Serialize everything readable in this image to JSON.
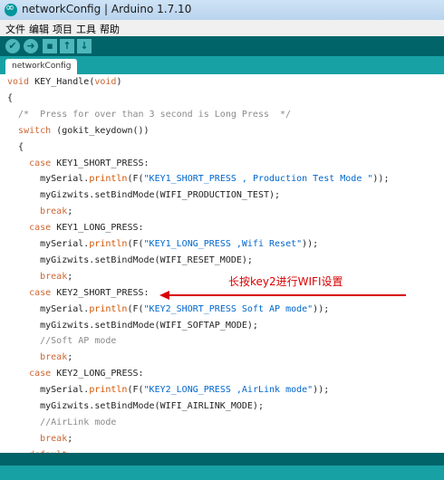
{
  "window": {
    "title": "networkConfig | Arduino 1.7.10"
  },
  "menu": [
    "文件",
    "编辑",
    "项目",
    "工具",
    "帮助"
  ],
  "toolbar": {
    "buttons": [
      {
        "name": "verify",
        "glyph": "✔"
      },
      {
        "name": "upload",
        "glyph": "➜"
      },
      {
        "name": "new",
        "glyph": "▪"
      },
      {
        "name": "open",
        "glyph": "↑"
      },
      {
        "name": "save",
        "glyph": "↓"
      }
    ]
  },
  "tab": {
    "label": "networkConfig"
  },
  "code": {
    "lines": [
      [
        {
          "t": "void",
          "c": "kw"
        },
        {
          "t": " KEY_Handle("
        },
        {
          "t": "void",
          "c": "kw"
        },
        {
          "t": ")"
        }
      ],
      [
        {
          "t": "{"
        }
      ],
      [
        {
          "t": "  /*  Press for over than 3 second is Long Press  */",
          "c": "cmt"
        }
      ],
      [
        {
          "t": "  "
        },
        {
          "t": "switch",
          "c": "kw"
        },
        {
          "t": " (gokit_keydown())"
        }
      ],
      [
        {
          "t": "  {"
        }
      ],
      [
        {
          "t": "    "
        },
        {
          "t": "case",
          "c": "kw"
        },
        {
          "t": " KEY1_SHORT_PRESS:"
        }
      ],
      [
        {
          "t": "      mySerial."
        },
        {
          "t": "println",
          "c": "fn"
        },
        {
          "t": "(F("
        },
        {
          "t": "\"KEY1_SHORT_PRESS , Production Test Mode \"",
          "c": "str"
        },
        {
          "t": "));"
        }
      ],
      [
        {
          "t": "      myGizwits.setBindMode(WIFI_PRODUCTION_TEST);"
        }
      ],
      [
        {
          "t": "      "
        },
        {
          "t": "break",
          "c": "kw"
        },
        {
          "t": ";"
        }
      ],
      [
        {
          "t": "    "
        },
        {
          "t": "case",
          "c": "kw"
        },
        {
          "t": " KEY1_LONG_PRESS:"
        }
      ],
      [
        {
          "t": "      mySerial."
        },
        {
          "t": "println",
          "c": "fn"
        },
        {
          "t": "(F("
        },
        {
          "t": "\"KEY1_LONG_PRESS ,Wifi Reset\"",
          "c": "str"
        },
        {
          "t": "));"
        }
      ],
      [
        {
          "t": "      myGizwits.setBindMode(WIFI_RESET_MODE);"
        }
      ],
      [
        {
          "t": "      "
        },
        {
          "t": "break",
          "c": "kw"
        },
        {
          "t": ";"
        }
      ],
      [
        {
          "t": "    "
        },
        {
          "t": "case",
          "c": "kw"
        },
        {
          "t": " KEY2_SHORT_PRESS:"
        }
      ],
      [
        {
          "t": "      mySerial."
        },
        {
          "t": "println",
          "c": "fn"
        },
        {
          "t": "(F("
        },
        {
          "t": "\"KEY2_SHORT_PRESS Soft AP mode\"",
          "c": "str"
        },
        {
          "t": "));"
        }
      ],
      [
        {
          "t": "      myGizwits.setBindMode(WIFI_SOFTAP_MODE);"
        }
      ],
      [
        {
          "t": "      //Soft AP mode",
          "c": "cmt"
        }
      ],
      [
        {
          "t": "      "
        },
        {
          "t": "break",
          "c": "kw"
        },
        {
          "t": ";"
        }
      ],
      [
        {
          "t": "    "
        },
        {
          "t": "case",
          "c": "kw"
        },
        {
          "t": " KEY2_LONG_PRESS:"
        }
      ],
      [
        {
          "t": "      mySerial."
        },
        {
          "t": "println",
          "c": "fn"
        },
        {
          "t": "(F("
        },
        {
          "t": "\"KEY2_LONG_PRESS ,AirLink mode\"",
          "c": "str"
        },
        {
          "t": "));"
        }
      ],
      [
        {
          "t": "      myGizwits.setBindMode(WIFI_AIRLINK_MODE);"
        }
      ],
      [
        {
          "t": "      //AirLink mode",
          "c": "cmt"
        }
      ],
      [
        {
          "t": "      "
        },
        {
          "t": "break",
          "c": "kw"
        },
        {
          "t": ";"
        }
      ],
      [
        {
          "t": "    "
        },
        {
          "t": "default",
          "c": "kw"
        },
        {
          "t": ":"
        }
      ]
    ]
  },
  "annotation": {
    "text": "长按key2进行WIFI设置",
    "color": "#d90000"
  }
}
